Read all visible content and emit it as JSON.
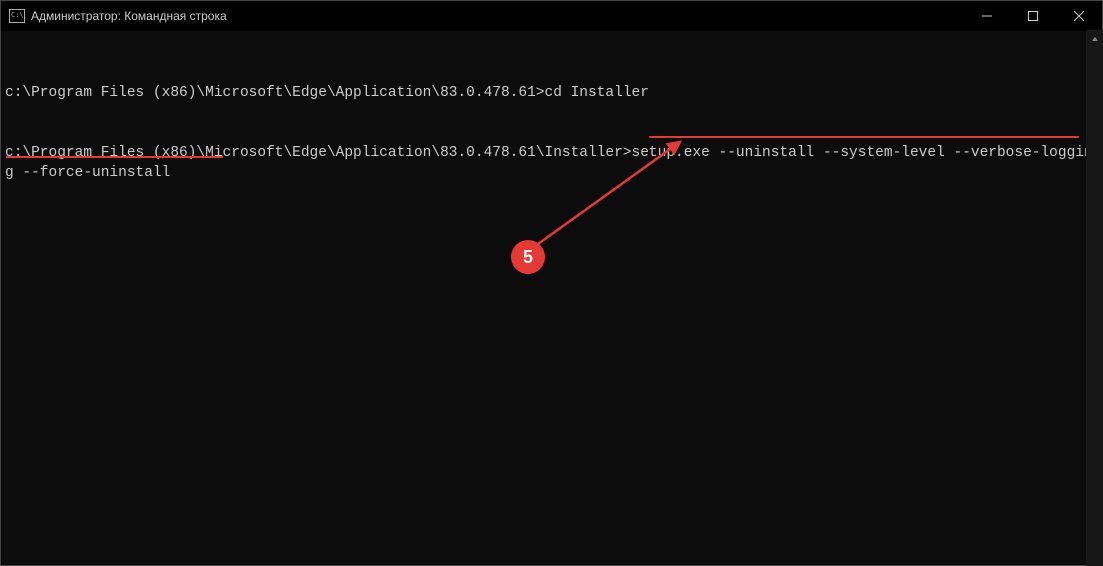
{
  "window": {
    "title": "Администратор: Командная строка"
  },
  "terminal": {
    "line1_prompt": "c:\\Program Files (x86)\\Microsoft\\Edge\\Application\\83.0.478.61>",
    "line1_cmd": "cd Installer",
    "blank": "",
    "line2_prompt": "c:\\Program Files (x86)\\Microsoft\\Edge\\Application\\83.0.478.61\\Installer>",
    "line2_cmd": "setup.exe --uninstall --system-level --verbose-logging --force-uninstall"
  },
  "annotation": {
    "number": "5",
    "color": "#e53935"
  }
}
